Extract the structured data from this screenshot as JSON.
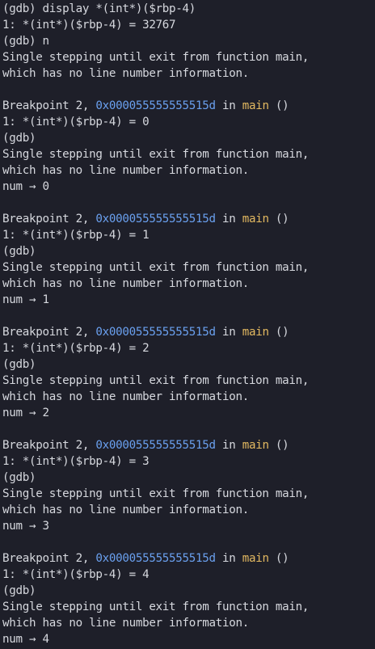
{
  "colors": {
    "background": "#1e1f29",
    "text": "#d6d8de",
    "address": "#6aa0ef",
    "function_name": "#e2b860"
  },
  "lines": [
    "(gdb) display *(int*)($rbp-4)",
    "1: *(int*)($rbp-4) = 32767",
    "(gdb) n",
    "Single stepping until exit from function main,",
    "which has no line number information.",
    "",
    {
      "bp_prefix": "Breakpoint 2, ",
      "address": "0x000055555555515d",
      "in_text": " in ",
      "func": "main",
      "suffix": " ()"
    },
    "1: *(int*)($rbp-4) = 0",
    "(gdb)",
    "Single stepping until exit from function main,",
    "which has no line number information.",
    "num → 0",
    "",
    {
      "bp_prefix": "Breakpoint 2, ",
      "address": "0x000055555555515d",
      "in_text": " in ",
      "func": "main",
      "suffix": " ()"
    },
    "1: *(int*)($rbp-4) = 1",
    "(gdb)",
    "Single stepping until exit from function main,",
    "which has no line number information.",
    "num → 1",
    "",
    {
      "bp_prefix": "Breakpoint 2, ",
      "address": "0x000055555555515d",
      "in_text": " in ",
      "func": "main",
      "suffix": " ()"
    },
    "1: *(int*)($rbp-4) = 2",
    "(gdb)",
    "Single stepping until exit from function main,",
    "which has no line number information.",
    "num → 2",
    "",
    {
      "bp_prefix": "Breakpoint 2, ",
      "address": "0x000055555555515d",
      "in_text": " in ",
      "func": "main",
      "suffix": " ()"
    },
    "1: *(int*)($rbp-4) = 3",
    "(gdb)",
    "Single stepping until exit from function main,",
    "which has no line number information.",
    "num → 3",
    "",
    {
      "bp_prefix": "Breakpoint 2, ",
      "address": "0x000055555555515d",
      "in_text": " in ",
      "func": "main",
      "suffix": " ()"
    },
    "1: *(int*)($rbp-4) = 4",
    "(gdb)",
    "Single stepping until exit from function main,",
    "which has no line number information.",
    "num → 4"
  ]
}
